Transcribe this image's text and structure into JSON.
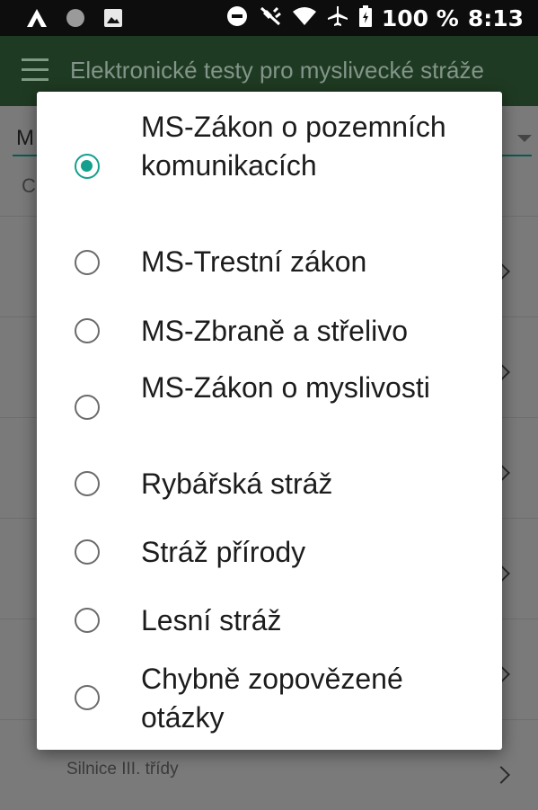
{
  "status_bar": {
    "battery": "100 %",
    "time": "8:13",
    "icons_left": [
      "app-a-icon",
      "circle-icon",
      "image-icon"
    ],
    "icons_right": [
      "do-not-disturb-icon",
      "satellite-off-icon",
      "wifi-icon",
      "airplane-icon",
      "battery-icon"
    ]
  },
  "app_bar": {
    "title": "Elektronické testy pro myslivecké stráže",
    "menu_icon": "hamburger-menu-icon"
  },
  "background": {
    "select_value": "M",
    "filter_text": "C",
    "partial_item": "Silnice III. třídy"
  },
  "dialog": {
    "selected_index": 0,
    "options": [
      {
        "label": "MS-Zákon o pozemních komunikacích",
        "selected": true
      },
      {
        "label": "MS-Trestní zákon",
        "selected": false
      },
      {
        "label": "MS-Zbraně a střelivo",
        "selected": false
      },
      {
        "label": "MS-Zákon o myslivosti",
        "selected": false
      },
      {
        "label": "Rybářská stráž",
        "selected": false
      },
      {
        "label": "Stráž přírody",
        "selected": false
      },
      {
        "label": "Lesní stráž",
        "selected": false
      },
      {
        "label": "Chybně zopovězené otázky",
        "selected": false
      }
    ]
  },
  "colors": {
    "accent": "#14a08c",
    "app_bar": "#2e6b35",
    "status_bar": "#0d0d0d"
  }
}
